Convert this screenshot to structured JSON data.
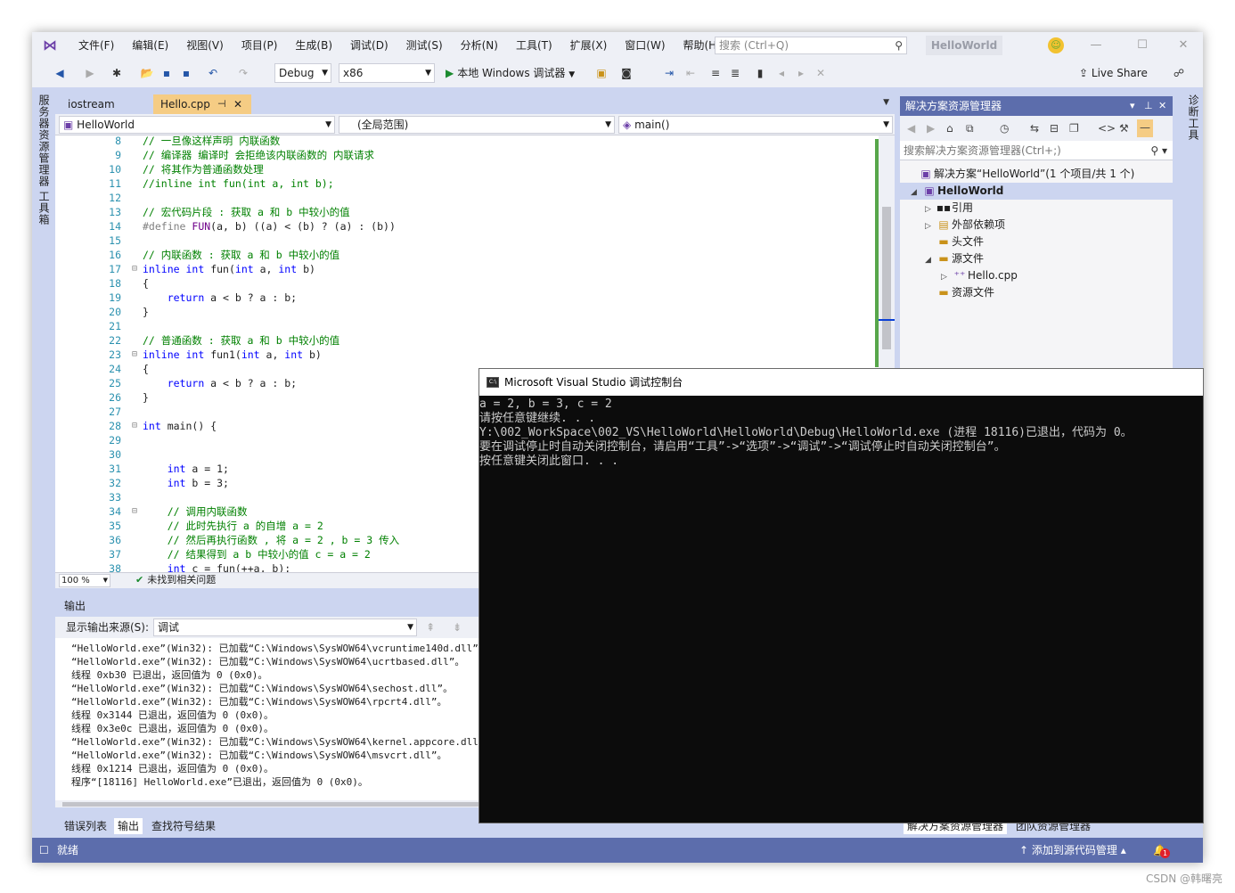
{
  "menubar": {
    "items": [
      "文件(F)",
      "编辑(E)",
      "视图(V)",
      "项目(P)",
      "生成(B)",
      "调试(D)",
      "测试(S)",
      "分析(N)",
      "工具(T)",
      "扩展(X)",
      "窗口(W)",
      "帮助(H)"
    ],
    "search_placeholder": "搜索 (Ctrl+Q)",
    "solution_name": "HelloWorld"
  },
  "toolbar": {
    "config": "Debug",
    "platform": "x86",
    "debugger": "本地 Windows 调试器",
    "live_share": "Live Share"
  },
  "left_strip": {
    "tab1": "服务器资源管理器",
    "tab2": "工具箱"
  },
  "right_strip": {
    "tab1": "诊断工具"
  },
  "editor": {
    "tabs": [
      {
        "label": "iostream"
      },
      {
        "label": "Hello.cpp"
      }
    ],
    "nav_project": "HelloWorld",
    "nav_scope": "(全局范围)",
    "nav_member": "main()",
    "zoom": "100 %",
    "issues": "未找到相关问题"
  },
  "code_lines": [
    {
      "n": "8",
      "t": "// 一旦像这样声明 内联函数",
      "c": "cmt"
    },
    {
      "n": "9",
      "t": "// 编译器 编译时 会拒绝该内联函数的 内联请求",
      "c": "cmt"
    },
    {
      "n": "10",
      "t": "// 将其作为普通函数处理",
      "c": "cmt"
    },
    {
      "n": "11",
      "t": "//inline int fun(int a, int b);",
      "c": "cmt"
    },
    {
      "n": "12",
      "t": "",
      "c": ""
    },
    {
      "n": "13",
      "t": "// 宏代码片段 : 获取 a 和 b 中较小的值",
      "c": "cmt"
    },
    {
      "n": "14",
      "t": "#define FUN(a, b) ((a) < (b) ? (a) : (b))",
      "c": "pp"
    },
    {
      "n": "15",
      "t": "",
      "c": ""
    },
    {
      "n": "16",
      "t": "// 内联函数 : 获取 a 和 b 中较小的值",
      "c": "cmt"
    },
    {
      "n": "17",
      "t": "inline int fun(int a, int b)",
      "c": "kw",
      "fold": "⊟"
    },
    {
      "n": "18",
      "t": "{",
      "c": ""
    },
    {
      "n": "19",
      "t": "    return a < b ? a : b;",
      "c": "kw"
    },
    {
      "n": "20",
      "t": "}",
      "c": ""
    },
    {
      "n": "21",
      "t": "",
      "c": ""
    },
    {
      "n": "22",
      "t": "// 普通函数 : 获取 a 和 b 中较小的值",
      "c": "cmt"
    },
    {
      "n": "23",
      "t": "inline int fun1(int a, int b)",
      "c": "kw",
      "fold": "⊟"
    },
    {
      "n": "24",
      "t": "{",
      "c": ""
    },
    {
      "n": "25",
      "t": "    return a < b ? a : b;",
      "c": "kw"
    },
    {
      "n": "26",
      "t": "}",
      "c": ""
    },
    {
      "n": "27",
      "t": "",
      "c": ""
    },
    {
      "n": "28",
      "t": "int main() {",
      "c": "kw",
      "fold": "⊟"
    },
    {
      "n": "29",
      "t": "",
      "c": ""
    },
    {
      "n": "30",
      "t": "",
      "c": ""
    },
    {
      "n": "31",
      "t": "    int a = 1;",
      "c": "kw"
    },
    {
      "n": "32",
      "t": "    int b = 3;",
      "c": "kw"
    },
    {
      "n": "33",
      "t": "",
      "c": ""
    },
    {
      "n": "34",
      "t": "    // 调用内联函数",
      "c": "cmt",
      "fold": "⊟"
    },
    {
      "n": "35",
      "t": "    // 此时先执行 a 的自增 a = 2",
      "c": "cmt"
    },
    {
      "n": "36",
      "t": "    // 然后再执行函数 , 将 a = 2 , b = 3 传入",
      "c": "cmt"
    },
    {
      "n": "37",
      "t": "    // 结果得到 a b 中较小的值 c = a = 2",
      "c": "cmt"
    },
    {
      "n": "38",
      "t": "    int c = fun(++a, b);",
      "c": "kw"
    }
  ],
  "output": {
    "title": "输出",
    "source_label": "显示输出来源(S):",
    "source_value": "调试",
    "lines": [
      "“HelloWorld.exe”(Win32): 已加载“C:\\Windows\\SysWOW64\\vcruntime140d.dll”。",
      "“HelloWorld.exe”(Win32): 已加载“C:\\Windows\\SysWOW64\\ucrtbased.dll”。",
      "线程 0xb30 已退出，返回值为 0 (0x0)。",
      "“HelloWorld.exe”(Win32): 已加载“C:\\Windows\\SysWOW64\\sechost.dll”。",
      "“HelloWorld.exe”(Win32): 已加载“C:\\Windows\\SysWOW64\\rpcrt4.dll”。",
      "线程 0x3144 已退出，返回值为 0 (0x0)。",
      "线程 0x3e0c 已退出，返回值为 0 (0x0)。",
      "“HelloWorld.exe”(Win32): 已加载“C:\\Windows\\SysWOW64\\kernel.appcore.dll”。",
      "“HelloWorld.exe”(Win32): 已加载“C:\\Windows\\SysWOW64\\msvcrt.dll”。",
      "线程 0x1214 已退出，返回值为 0 (0x0)。",
      "程序“[18116] HelloWorld.exe”已退出，返回值为 0 (0x0)。"
    ],
    "bottom_tabs": [
      "错误列表",
      "输出",
      "查找符号结果"
    ]
  },
  "solution_explorer": {
    "title": "解决方案资源管理器",
    "search_placeholder": "搜索解决方案资源管理器(Ctrl+;)",
    "tree": {
      "solution": "解决方案“HelloWorld”(1 个项目/共 1 个)",
      "project": "HelloWorld",
      "references": "引用",
      "external_deps": "外部依赖项",
      "headers": "头文件",
      "sources": "源文件",
      "hello_cpp": "Hello.cpp",
      "resources": "资源文件"
    },
    "bottom_tabs": [
      "解决方案资源管理器",
      "团队资源管理器"
    ]
  },
  "statusbar": {
    "ready": "就绪",
    "source_control": "添加到源代码管理",
    "notification_count": "1"
  },
  "console": {
    "title": "Microsoft Visual Studio 调试控制台",
    "icon_text": "C:\\",
    "lines": [
      "a = 2, b = 3, c = 2",
      "请按任意键继续. . .",
      "",
      "Y:\\002_WorkSpace\\002_VS\\HelloWorld\\HelloWorld\\Debug\\HelloWorld.exe (进程 18116)已退出，代码为 0。",
      "要在调试停止时自动关闭控制台，请启用“工具”->“选项”->“调试”->“调试停止时自动关闭控制台”。",
      "按任意键关闭此窗口. . ."
    ]
  },
  "watermark": "CSDN @韩曙亮",
  "colors": {
    "accent": "#5c6dac",
    "active_tab": "#f5cc84",
    "comment": "#008000",
    "keyword": "#0000ff"
  }
}
